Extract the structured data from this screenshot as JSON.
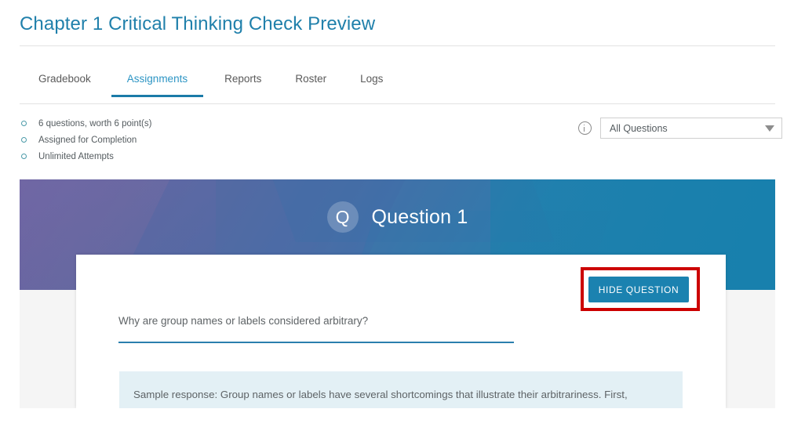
{
  "header": {
    "title": "Chapter 1 Critical Thinking Check Preview",
    "title_color": "#2080ab"
  },
  "tabs": {
    "items": [
      {
        "label": "Gradebook",
        "active": false
      },
      {
        "label": "Assignments",
        "active": true
      },
      {
        "label": "Reports",
        "active": false
      },
      {
        "label": "Roster",
        "active": false
      },
      {
        "label": "Logs",
        "active": false
      }
    ],
    "active_underline_color": "#1b7ba8"
  },
  "meta": {
    "items": [
      "6 questions, worth 6 point(s)",
      "Assigned for Completion",
      "Unlimited Attempts"
    ]
  },
  "filter": {
    "info_icon": "info-circle-icon",
    "selected": "All Questions",
    "caret_icon": "chevron-down-icon"
  },
  "question_banner": {
    "badge_letter": "Q",
    "title": "Question 1",
    "gradient_start": "#6b63a0",
    "gradient_end": "#1880ab"
  },
  "question_card": {
    "hide_button_label": "HIDE QUESTION",
    "hide_button_color": "#1b82b0",
    "highlight_color": "#cc0000",
    "prompt": "Why are group names or labels considered arbitrary?",
    "prompt_underline_color": "#2a7fae",
    "sample_response": "Sample response: Group names or labels have several shortcomings that illustrate their arbitrariness. First,",
    "sample_background": "#e3f0f5"
  }
}
